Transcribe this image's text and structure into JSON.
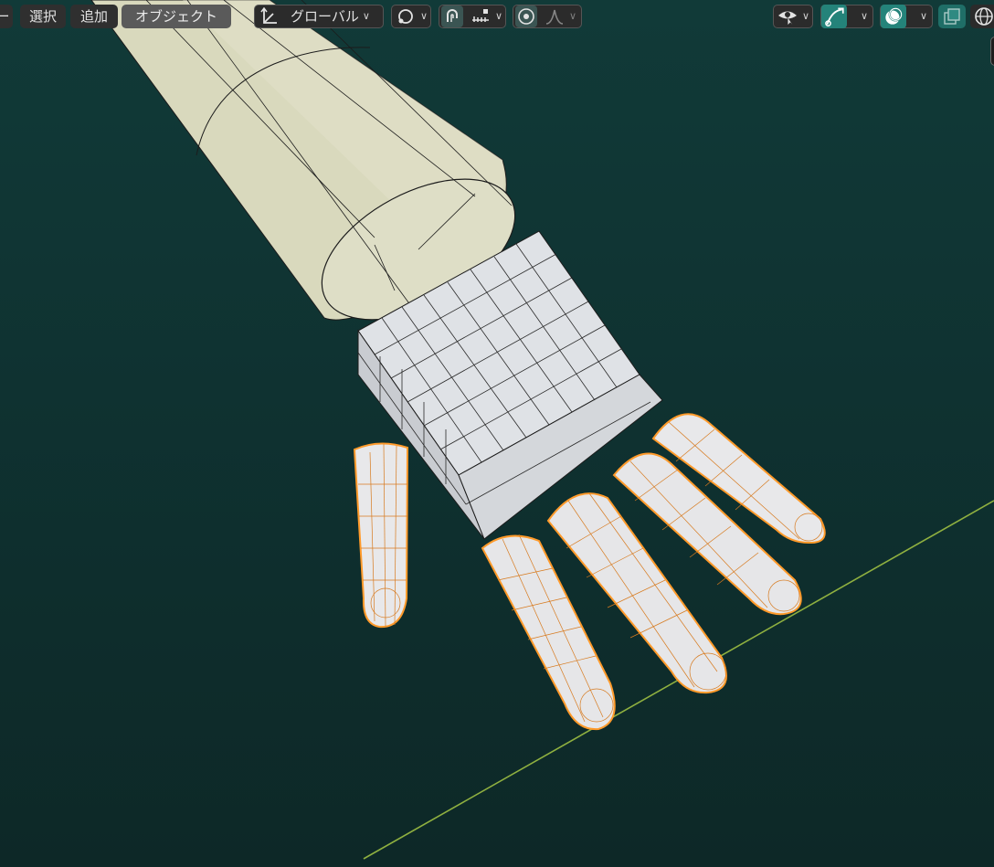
{
  "header": {
    "menu_partial": "ー",
    "menu_select": "選択",
    "menu_add": "追加",
    "menu_object": "オブジェクト",
    "orientation_label": "グローバル"
  },
  "icons": [
    "transform-orientation-icon",
    "pivot-point-icon",
    "snap-magnet-icon",
    "snap-increment-icon",
    "proportional-editing-icon",
    "falloff-curve-icon",
    "visibility-selectability-icon",
    "gizmo-icon",
    "overlays-icon",
    "xray-icon",
    "wireframe-shading-icon"
  ],
  "colors": {
    "viewport_bg": "#0f3231",
    "arm": "#dcdcc0",
    "palm": "#dfe2e6",
    "finger": "#e8e8ea",
    "selected_outline": "#ff9a2a",
    "grid_axis": "#8fb040",
    "active_button": "#24837a"
  }
}
